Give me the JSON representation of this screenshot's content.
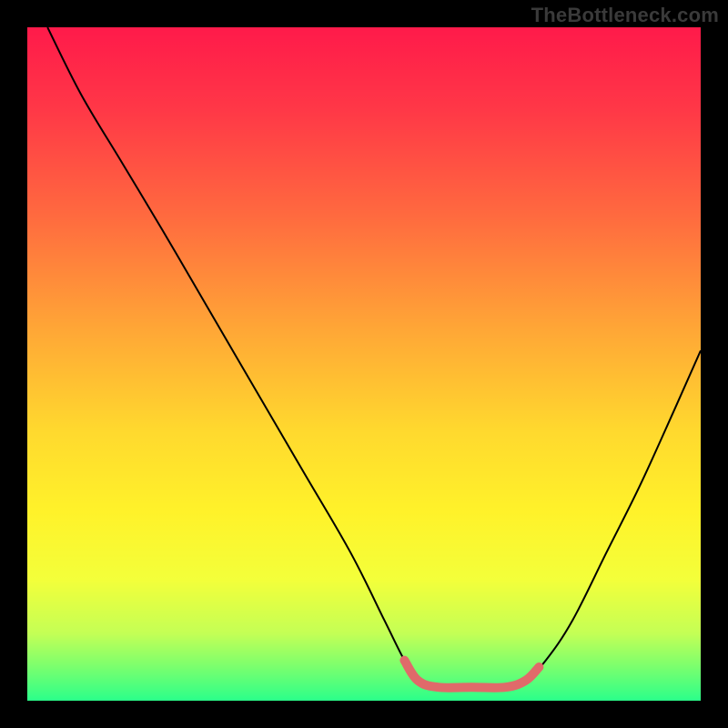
{
  "watermark": "TheBottleneck.com",
  "chart_data": {
    "type": "line",
    "title": "",
    "xlabel": "",
    "ylabel": "",
    "ylim": [
      0,
      100
    ],
    "xlim": [
      0,
      100
    ],
    "gradient": {
      "stops": [
        {
          "offset": 0,
          "color": "#ff1a4a"
        },
        {
          "offset": 0.12,
          "color": "#ff3747"
        },
        {
          "offset": 0.28,
          "color": "#ff6a3f"
        },
        {
          "offset": 0.45,
          "color": "#ffa736"
        },
        {
          "offset": 0.6,
          "color": "#ffd92e"
        },
        {
          "offset": 0.72,
          "color": "#fff22a"
        },
        {
          "offset": 0.82,
          "color": "#f3ff3a"
        },
        {
          "offset": 0.9,
          "color": "#c4ff55"
        },
        {
          "offset": 0.95,
          "color": "#7aff6e"
        },
        {
          "offset": 1.0,
          "color": "#2bff8a"
        }
      ]
    },
    "series": [
      {
        "name": "curve",
        "stroke": "#000000",
        "width": 2,
        "points": [
          {
            "x": 3,
            "y": 100
          },
          {
            "x": 8,
            "y": 90
          },
          {
            "x": 14,
            "y": 80
          },
          {
            "x": 20,
            "y": 70
          },
          {
            "x": 27,
            "y": 58
          },
          {
            "x": 34,
            "y": 46
          },
          {
            "x": 41,
            "y": 34
          },
          {
            "x": 48,
            "y": 22
          },
          {
            "x": 53,
            "y": 12
          },
          {
            "x": 56,
            "y": 6
          },
          {
            "x": 58,
            "y": 3
          },
          {
            "x": 61,
            "y": 2
          },
          {
            "x": 66,
            "y": 2
          },
          {
            "x": 71,
            "y": 2
          },
          {
            "x": 74,
            "y": 3
          },
          {
            "x": 77,
            "y": 6
          },
          {
            "x": 81,
            "y": 12
          },
          {
            "x": 86,
            "y": 22
          },
          {
            "x": 91,
            "y": 32
          },
          {
            "x": 96,
            "y": 43
          },
          {
            "x": 100,
            "y": 52
          }
        ]
      },
      {
        "name": "highlight-segment",
        "stroke": "#e06a6a",
        "width": 10,
        "linecap": "round",
        "threshold_y": 6,
        "points": [
          {
            "x": 56,
            "y": 6
          },
          {
            "x": 58,
            "y": 3
          },
          {
            "x": 61,
            "y": 2
          },
          {
            "x": 66,
            "y": 2
          },
          {
            "x": 71,
            "y": 2
          },
          {
            "x": 74,
            "y": 3
          },
          {
            "x": 76,
            "y": 5
          }
        ]
      }
    ]
  }
}
